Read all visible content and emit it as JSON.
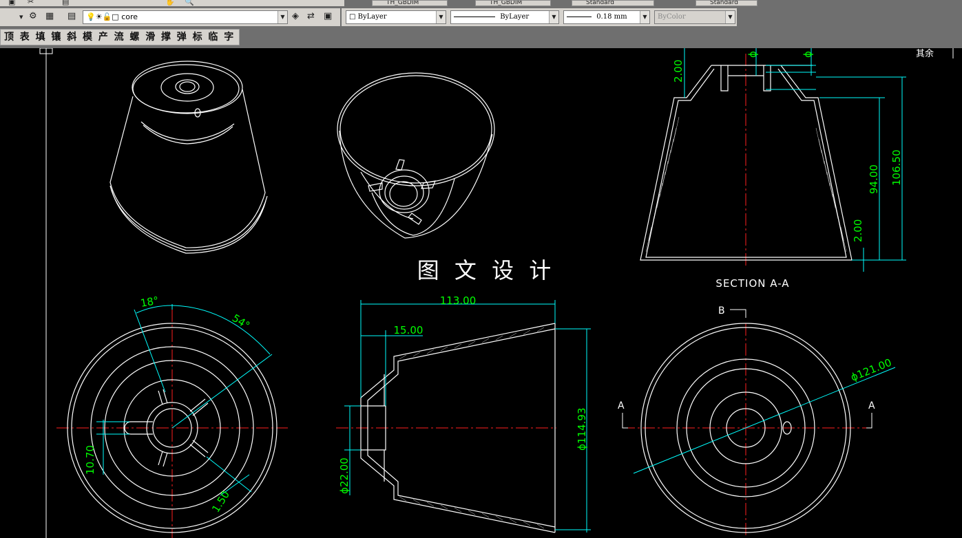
{
  "toolbar": {
    "layer_name": "core",
    "color_control": "ByLayer",
    "linetype_control": "ByLayer",
    "lineweight_control": "0.18 mm",
    "plotstyle_control": "ByColor",
    "dimstyle_1": "TH_GBDIM",
    "dimstyle_2": "TH_GBDIM",
    "textstyle": "Standard",
    "tablestyle": "Standard"
  },
  "menu": {
    "items": [
      "顶",
      "表",
      "填",
      "镶",
      "斜",
      "模",
      "产",
      "流",
      "螺",
      "滑",
      "撑",
      "弹",
      "标",
      "临",
      "字"
    ]
  },
  "drawing": {
    "watermark": "图 文 设 计",
    "section_label": "SECTION A-A",
    "corner_text": "其余",
    "section_marker_a": "A",
    "section_marker_b": "B",
    "dims": {
      "top_thickness": "2.00",
      "total_height": "106.50",
      "inner_height": "94.00",
      "wall_thickness": "2.00",
      "angle_small": "18°",
      "angle_large": "54°",
      "rib_width": "10.70",
      "rib_thickness": "1.50",
      "overall_length": "113.00",
      "neck_length": "15.00",
      "bore_dia": "ϕ22.00",
      "outer_dia": "ϕ114.93",
      "rim_dia": "ϕ121.00",
      "phi_1": "ϕ",
      "phi_2": "ϕ"
    }
  },
  "colors": {
    "background": "#000000",
    "line": "#ffffff",
    "center_line": "#ff2020",
    "dimension": "#00ff00",
    "dimension_line": "#00ffff",
    "toolbar": "#d6d3ce"
  }
}
